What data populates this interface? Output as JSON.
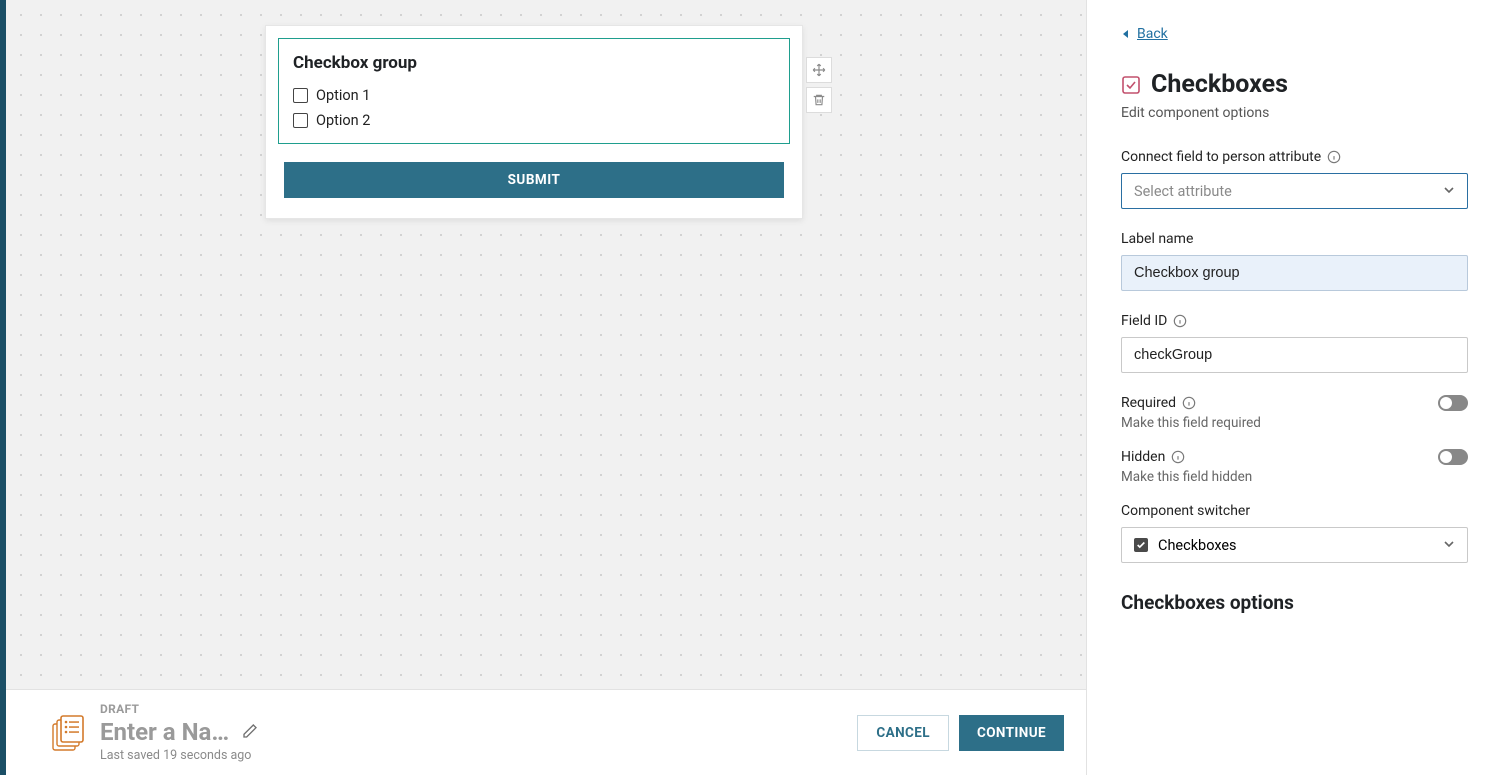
{
  "canvas": {
    "component_title": "Checkbox group",
    "options": [
      "Option 1",
      "Option 2"
    ],
    "submit_label": "SUBMIT"
  },
  "footer": {
    "draft_label": "DRAFT",
    "name_placeholder": "Enter a Name",
    "last_saved": "Last saved 19 seconds ago",
    "cancel_label": "CANCEL",
    "continue_label": "CONTINUE"
  },
  "panel": {
    "back_label": "Back",
    "title": "Checkboxes",
    "subtitle": "Edit component options",
    "connect_label": "Connect field to person attribute",
    "connect_placeholder": "Select attribute",
    "label_name_label": "Label name",
    "label_name_value": "Checkbox group",
    "field_id_label": "Field ID",
    "field_id_value": "checkGroup",
    "required_label": "Required",
    "required_desc": "Make this field required",
    "hidden_label": "Hidden",
    "hidden_desc": "Make this field hidden",
    "switcher_label": "Component switcher",
    "switcher_value": "Checkboxes",
    "options_heading": "Checkboxes options"
  }
}
